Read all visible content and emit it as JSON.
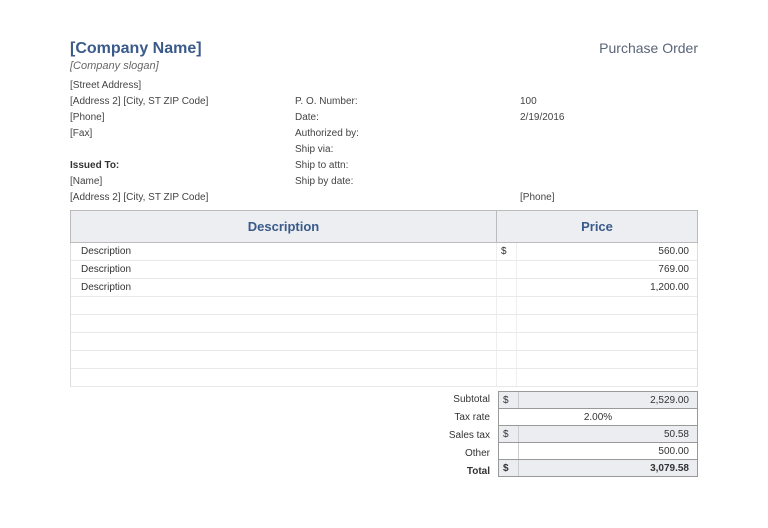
{
  "header": {
    "company_name": "[Company Name]",
    "slogan": "[Company slogan]",
    "doc_title": "Purchase Order"
  },
  "address": {
    "street": "[Street Address]",
    "city_line": "[Address 2] [City, ST ZIP Code]",
    "phone": "[Phone]",
    "fax": "[Fax]"
  },
  "po_fields": {
    "po_number_label": "P. O. Number:",
    "po_number_value": "100",
    "date_label": "Date:",
    "date_value": "2/19/2016",
    "authorized_label": "Authorized by:",
    "ship_via_label": "Ship via:",
    "ship_attn_label": "Ship to attn:",
    "ship_by_label": "Ship by date:"
  },
  "issued_to": {
    "header": "Issued To:",
    "name": "[Name]",
    "address": "[Address 2] [City, ST ZIP Code]",
    "phone": "[Phone]"
  },
  "table": {
    "desc_header": "Description",
    "price_header": "Price",
    "currency": "$",
    "rows": [
      {
        "desc": "Description",
        "price": "560.00"
      },
      {
        "desc": "Description",
        "price": "769.00"
      },
      {
        "desc": "Description",
        "price": "1,200.00"
      }
    ]
  },
  "totals": {
    "subtotal_label": "Subtotal",
    "subtotal_value": "2,529.00",
    "tax_rate_label": "Tax rate",
    "tax_rate_value": "2.00%",
    "sales_tax_label": "Sales tax",
    "sales_tax_value": "50.58",
    "other_label": "Other",
    "other_value": "500.00",
    "total_label": "Total",
    "total_value": "3,079.58",
    "currency": "$"
  }
}
